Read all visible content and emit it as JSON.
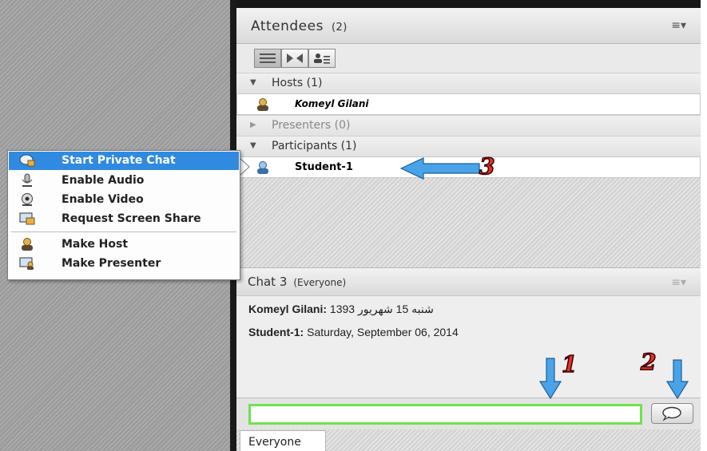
{
  "attendees": {
    "title": "Attendees",
    "count": "(2)",
    "groups": {
      "hosts": "Hosts (1)",
      "presenters": "Presenters (0)",
      "participants": "Participants (1)"
    },
    "host_name": "Komeyl Gilani",
    "participant_name": "Student-1"
  },
  "chat": {
    "title": "Chat 3",
    "subtitle": "(Everyone)",
    "messages": [
      {
        "sender": "Komeyl Gilani:",
        "text": "شنبه 15 شهریور 1393"
      },
      {
        "sender": "Student-1:",
        "text": "Saturday, September 06, 2014"
      }
    ],
    "input_value": "",
    "tab": "Everyone"
  },
  "context_menu": {
    "items": [
      {
        "label": "Start Private Chat",
        "icon": "private-chat-icon"
      },
      {
        "label": "Enable Audio",
        "icon": "microphone-icon"
      },
      {
        "label": "Enable Video",
        "icon": "webcam-icon"
      },
      {
        "label": "Request Screen Share",
        "icon": "screen-share-icon"
      },
      {
        "label": "Make Host",
        "icon": "host-icon"
      },
      {
        "label": "Make Presenter",
        "icon": "presenter-icon"
      }
    ]
  },
  "annotations": {
    "one": "1",
    "two": "2",
    "three": "3"
  },
  "colors": {
    "menu_highlight": "#2f8ae0",
    "input_border": "#6fe34d",
    "arrow": "#4aa3e8",
    "annotation_number": "#e7302e"
  }
}
